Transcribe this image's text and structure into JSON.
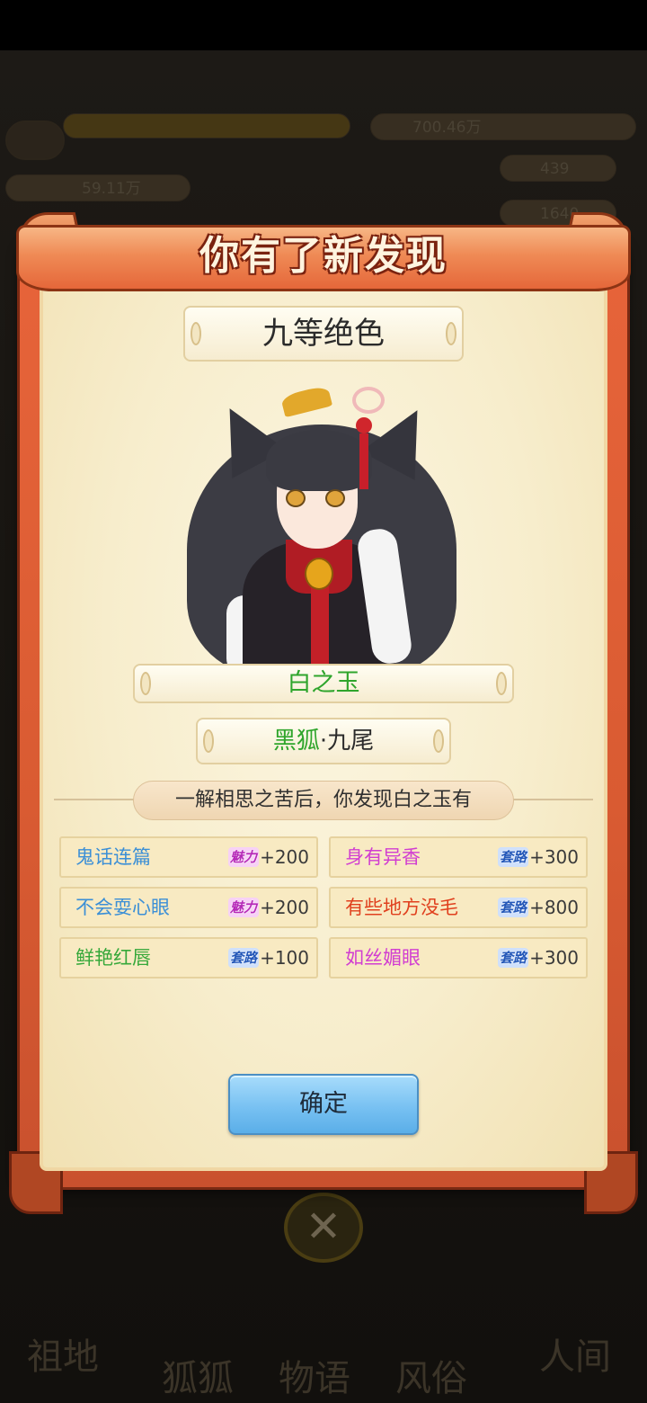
{
  "background": {
    "power_value": "700.46万",
    "charm_value": "59.11万",
    "res_1": "439",
    "res_2": "1640",
    "bottom_labels": [
      "祖地",
      "狐狐",
      "物语",
      "风俗",
      "人间"
    ]
  },
  "modal": {
    "title": "你有了新发现",
    "rank": "九等绝色",
    "character_name": "白之玉",
    "species_primary": "黑狐",
    "species_secondary": "·九尾",
    "discovery_text": "一解相思之苦后，你发现白之玉有",
    "traits": [
      {
        "name": "鬼话连篇",
        "badge": "魅力",
        "badge_type": "charm",
        "value": "+200",
        "color": "#3b8fd6"
      },
      {
        "name": "身有异香",
        "badge": "套路",
        "badge_type": "trick",
        "value": "+300",
        "color": "#d13ed1"
      },
      {
        "name": "不会耍心眼",
        "badge": "魅力",
        "badge_type": "charm",
        "value": "+200",
        "color": "#3b8fd6"
      },
      {
        "name": "有些地方没毛",
        "badge": "套路",
        "badge_type": "trick",
        "value": "+800",
        "color": "#e0401e"
      },
      {
        "name": "鲜艳红唇",
        "badge": "套路",
        "badge_type": "trick",
        "value": "+100",
        "color": "#36a83a"
      },
      {
        "name": "如丝媚眼",
        "badge": "套路",
        "badge_type": "trick",
        "value": "+300",
        "color": "#d13ed1"
      }
    ],
    "confirm_label": "确定"
  },
  "colors": {
    "frame": "#e2643a",
    "panel": "#f7edcc",
    "name_green": "#2fa52c",
    "button_blue": "#78c1f2"
  },
  "icons": {
    "close": "close-x-icon"
  }
}
